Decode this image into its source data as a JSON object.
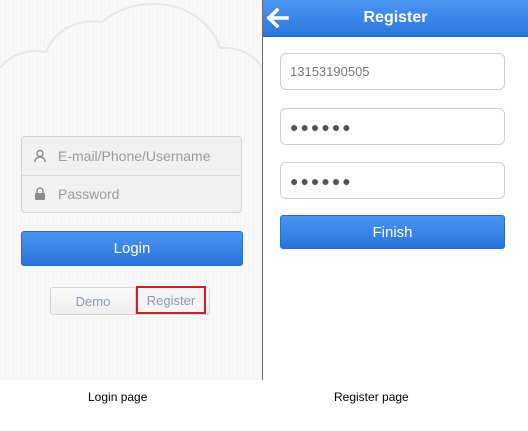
{
  "login": {
    "username_placeholder": "E-mail/Phone/Username",
    "password_placeholder": "Password",
    "login_label": "Login",
    "demo_label": "Demo",
    "register_label": "Register",
    "icons": {
      "username": "user-icon",
      "password": "lock-icon"
    },
    "highlight_color": "#c8202c"
  },
  "register": {
    "title": "Register",
    "phone_value": "13153190505",
    "password_value": "●●●●●●",
    "confirm_password_value": "●●●●●●",
    "finish_label": "Finish",
    "back_icon": "back-arrow-icon",
    "accent_color": "#2f7be3"
  },
  "captions": {
    "login": "Login page",
    "register": "Register page"
  }
}
